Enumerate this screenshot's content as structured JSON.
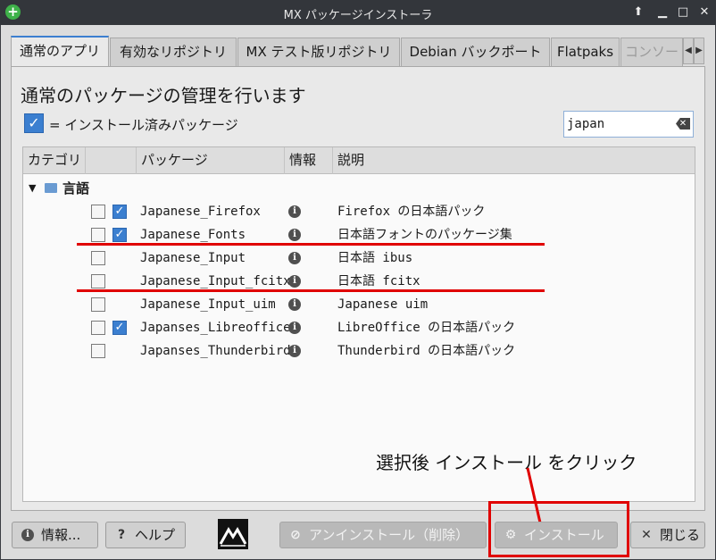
{
  "window": {
    "title": "MX パッケージインストーラ",
    "app_icon": "plus-icon"
  },
  "tabs": [
    {
      "label": "通常のアプリ"
    },
    {
      "label": "有効なリポジトリ"
    },
    {
      "label": "MX テスト版リポジトリ"
    },
    {
      "label": "Debian バックポート"
    },
    {
      "label": "Flatpaks"
    },
    {
      "label": "コンソー"
    }
  ],
  "panel": {
    "heading": "通常のパッケージの管理を行います",
    "legend": "= インストール済みパッケージ",
    "search_value": "japan"
  },
  "tree": {
    "columns": [
      "カテゴリ",
      "パッケージ",
      "情報",
      "説明"
    ],
    "category": "言語",
    "rows": [
      {
        "checked": true,
        "name": "Japanese_Firefox",
        "desc": "Firefox の日本語パック"
      },
      {
        "checked": true,
        "name": "Japanese_Fonts",
        "desc": "日本語フォントのパッケージ集"
      },
      {
        "checked": false,
        "name": "Japanese_Input",
        "desc": "日本語 ibus"
      },
      {
        "checked": false,
        "name": "Japanese_Input_fcitx",
        "desc": "日本語 fcitx"
      },
      {
        "checked": false,
        "name": "Japanese_Input_uim",
        "desc": "Japanese uim"
      },
      {
        "checked": true,
        "name": "Japanses_Libreoffice",
        "desc": "LibreOffice の日本語パック"
      },
      {
        "checked": false,
        "name": "Japanses_Thunderbird",
        "desc": "Thunderbird の日本語パック"
      }
    ]
  },
  "annotation": "選択後 インストール をクリック",
  "buttons": {
    "info": "情報...",
    "help": "ヘルプ",
    "uninstall": "アンインストール（削除）",
    "install": "インストール",
    "close": "閉じる"
  },
  "colors": {
    "accent": "#3b7fd0",
    "highlight": "#e00000"
  }
}
